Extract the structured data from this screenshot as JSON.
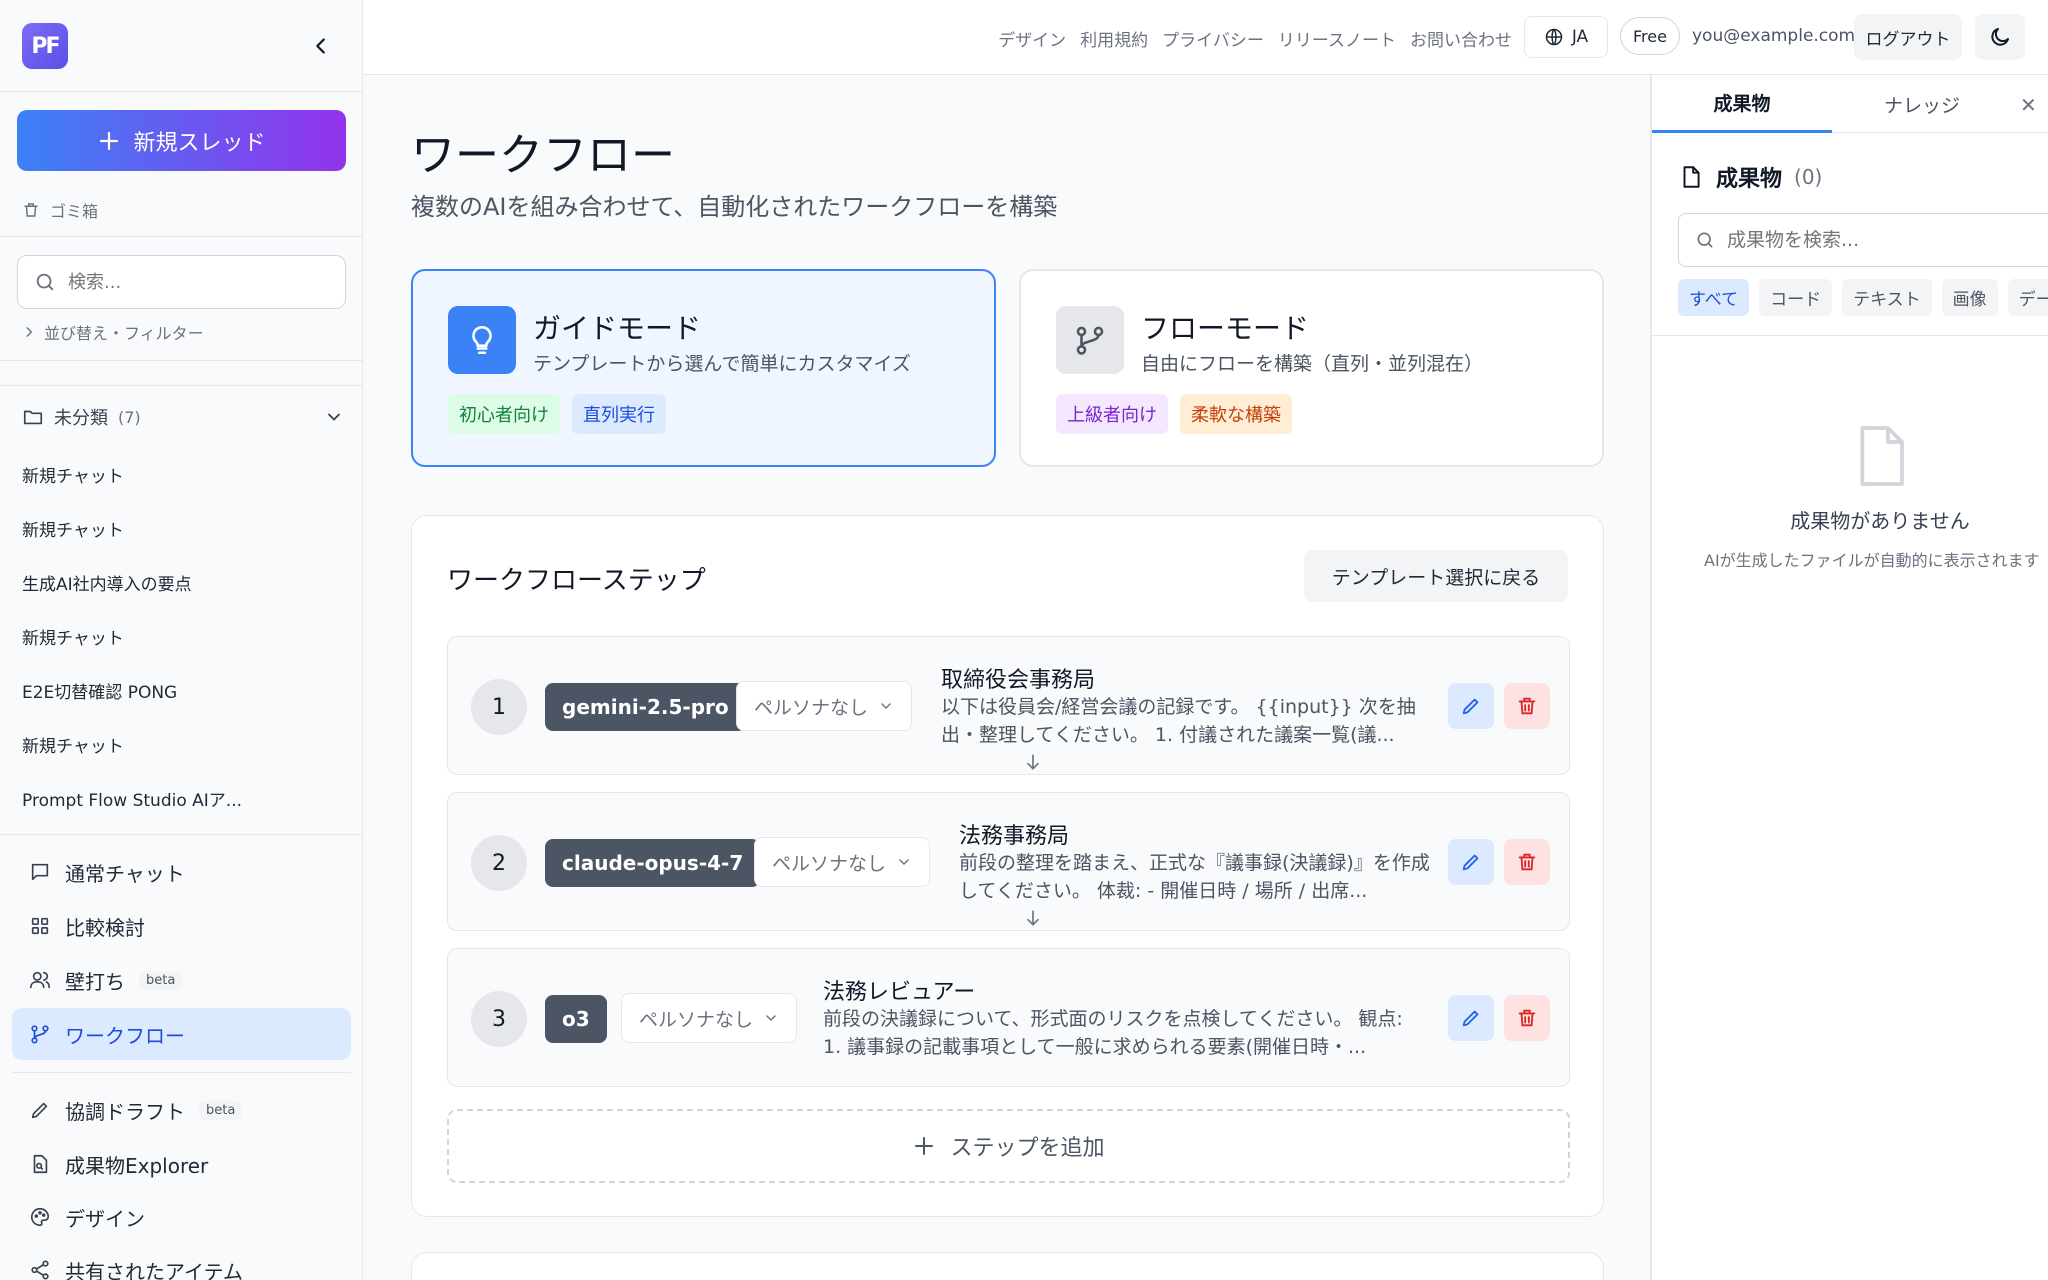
{
  "sidebar": {
    "logo_text": "PF",
    "new_thread": "新規スレッド",
    "trash": "ゴミ箱",
    "search_placeholder": "検索...",
    "sort_filter": "並び替え・フィルター",
    "folder": {
      "label": "未分類",
      "count": "(7)"
    },
    "chats": [
      "新規チャット",
      "新規チャット",
      "生成AI社内導入の要点",
      "新規チャット",
      "E2E切替確認 PONG",
      "新規チャット",
      "Prompt Flow Studio AIア..."
    ],
    "nav": [
      {
        "label": "通常チャット",
        "icon": "chat-icon"
      },
      {
        "label": "比較検討",
        "icon": "grid-icon"
      },
      {
        "label": "壁打ち",
        "icon": "users-icon",
        "badge": "beta"
      },
      {
        "label": "ワークフロー",
        "icon": "workflow-icon"
      },
      {
        "label": "協調ドラフト",
        "icon": "pen-icon",
        "badge": "beta"
      },
      {
        "label": "成果物Explorer",
        "icon": "file-search-icon"
      },
      {
        "label": "デザイン",
        "icon": "palette-icon"
      },
      {
        "label": "共有されたアイテム",
        "icon": "share-icon"
      }
    ]
  },
  "topbar": {
    "links": [
      "デザイン",
      "利用規約",
      "プライバシー",
      "リリースノート",
      "お問い合わせ"
    ],
    "lang": "JA",
    "plan": "Free",
    "email": "you@example.com",
    "logout": "ログアウト"
  },
  "main": {
    "title": "ワークフロー",
    "subtitle": "複数のAIを組み合わせて、自動化されたワークフローを構築",
    "modes": [
      {
        "title": "ガイドモード",
        "desc": "テンプレートから選んで簡単にカスタマイズ",
        "tags": [
          "初心者向け",
          "直列実行"
        ],
        "selected": true,
        "accent": "#3b82f6"
      },
      {
        "title": "フローモード",
        "desc": "自由にフローを構築（直列・並列混在）",
        "tags": [
          "上級者向け",
          "柔軟な構築"
        ],
        "selected": false,
        "accent": "#e5e7eb"
      }
    ],
    "steps_title": "ワークフローステップ",
    "back_button": "テンプレート選択に戻る",
    "steps": [
      {
        "num": "1",
        "model": "gemini-2.5-pro",
        "persona": "ペルソナなし",
        "name": "取締役会事務局",
        "prompt": "以下は役員会/経営会議の記録です。 {{input}} 次を抽出・整理してください。 1. 付議された議案一覧(議..."
      },
      {
        "num": "2",
        "model": "claude-opus-4-7",
        "persona": "ペルソナなし",
        "name": "法務事務局",
        "prompt": "前段の整理を踏まえ、正式な『議事録(決議録)』を作成してください。 体裁: - 開催日時 / 場所 / 出席..."
      },
      {
        "num": "3",
        "model": "o3",
        "persona": "ペルソナなし",
        "name": "法務レビュアー",
        "prompt": "前段の決議録について、形式面のリスクを点検してください。 観点: 1. 議事録の記載事項として一般に求められる要素(開催日時・..."
      }
    ],
    "add_step": "ステップを追加"
  },
  "rpanel": {
    "tabs": [
      "成果物",
      "ナレッジ"
    ],
    "heading": "成果物",
    "count": "(0)",
    "search_placeholder": "成果物を検索...",
    "filters": [
      "すべて",
      "コード",
      "テキスト",
      "画像",
      "データ"
    ],
    "empty_title": "成果物がありません",
    "empty_sub": "AIが生成したファイルが自動的に表示されます"
  },
  "colors": {
    "accent": "#3b82f6",
    "gradient_start": "#3b82f6",
    "gradient_end": "#9333ea",
    "danger": "#dc2626"
  }
}
